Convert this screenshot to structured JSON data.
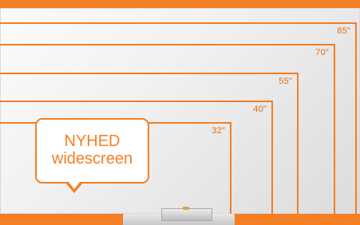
{
  "sizes": [
    {
      "label": "85\""
    },
    {
      "label": "70\""
    },
    {
      "label": "55\""
    },
    {
      "label": "40\""
    },
    {
      "label": "32\""
    }
  ],
  "bubble": {
    "line1": "NYHED",
    "line2": "widescreen"
  },
  "colors": {
    "accent": "#f47e24",
    "board": "#efefef"
  }
}
